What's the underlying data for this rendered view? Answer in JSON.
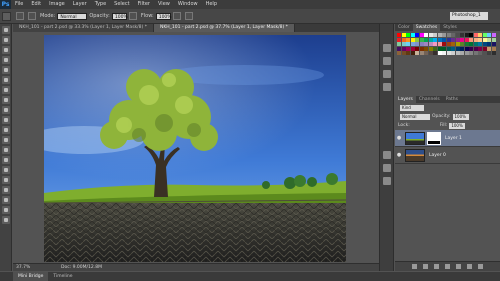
{
  "app": {
    "logo": "Ps",
    "menu": [
      "File",
      "Edit",
      "Image",
      "Layer",
      "Type",
      "Select",
      "Filter",
      "View",
      "Window",
      "Help"
    ]
  },
  "options": {
    "mode_label": "Mode:",
    "mode_value": "Normal",
    "opacity_label": "Opacity:",
    "opacity_value": "100%",
    "flow_label": "Flow:",
    "flow_value": "100%",
    "workspace": "Photoshop_1"
  },
  "document": {
    "tabs": [
      {
        "label": "NKH_101 - part 2.psd @ 33.3% (Layer 1, Layer Mask/8) *"
      },
      {
        "label": "NKH_101 - part 2.psd @ 37.7% (Layer 1, Layer Mask/8) *"
      }
    ],
    "zoom": "37.7%",
    "doc_size": "Doc: 9.00M/12.8M"
  },
  "bottom_tabs": [
    "Mini Bridge",
    "Timeline"
  ],
  "color_panel": {
    "tabs": [
      "Color",
      "Swatches",
      "Styles"
    ],
    "swatch_colors": [
      "#ff0000",
      "#ffff00",
      "#00ff00",
      "#00ffff",
      "#0000ff",
      "#ff00ff",
      "#ffffff",
      "#e6e6e6",
      "#cccccc",
      "#b3b3b3",
      "#999999",
      "#808080",
      "#666666",
      "#4d4d4d",
      "#333333",
      "#1a1a1a",
      "#000000",
      "#ff6666",
      "#ffcc66",
      "#66ff66",
      "#66ccff",
      "#cc66ff",
      "#ed1c24",
      "#f26522",
      "#f7941d",
      "#fff200",
      "#8dc63f",
      "#39b54a",
      "#00a651",
      "#00a99d",
      "#00aeef",
      "#0072bc",
      "#0054a6",
      "#2e3192",
      "#662d91",
      "#92278f",
      "#ec008c",
      "#ed145b",
      "#f69679",
      "#f9ad81",
      "#fdc68a",
      "#fff799",
      "#c4df9b",
      "#a3d39c",
      "#82ca9c",
      "#7accc8",
      "#6dcff6",
      "#7da7d9",
      "#8393ca",
      "#8781bd",
      "#a186be",
      "#bd8cbf",
      "#f49ac1",
      "#f5989d",
      "#9e0b0f",
      "#a0410d",
      "#a3620a",
      "#aba000",
      "#598527",
      "#197b30",
      "#007236",
      "#00746b",
      "#0076a3",
      "#004a80",
      "#003471",
      "#1b1464",
      "#440e62",
      "#630460",
      "#9e005d",
      "#9e0039",
      "#790000",
      "#7b2e00",
      "#7d4900",
      "#827b00",
      "#406618",
      "#005e20",
      "#005826",
      "#005952",
      "#005b7f",
      "#003663",
      "#002157",
      "#0d004c",
      "#32004b",
      "#4b0049",
      "#7b0046",
      "#7a0026",
      "#c69c6d",
      "#a67c52",
      "#8c6239",
      "#754c24",
      "#603913",
      "#42210b",
      "#c7b299",
      "#998675",
      "#736357",
      "#534741",
      "#362f2d",
      "#ffffff",
      "#f2f2f2",
      "#e0e0e0",
      "#cfcfcf",
      "#bdbdbd",
      "#ababab",
      "#999999",
      "#878787",
      "#757575",
      "#636363",
      "#525252",
      "#404040",
      "#2e2e2e"
    ]
  },
  "layers_panel": {
    "tabs": [
      "Layers",
      "Channels",
      "Paths"
    ],
    "kind_label": "Kind",
    "blend_mode": "Normal",
    "opacity_label": "Opacity:",
    "opacity_value": "100%",
    "lock_label": "Lock:",
    "fill_label": "Fill:",
    "fill_value": "100%",
    "layers": [
      {
        "name": "Layer 1",
        "selected": true
      },
      {
        "name": "Layer 0",
        "selected": false
      }
    ]
  }
}
